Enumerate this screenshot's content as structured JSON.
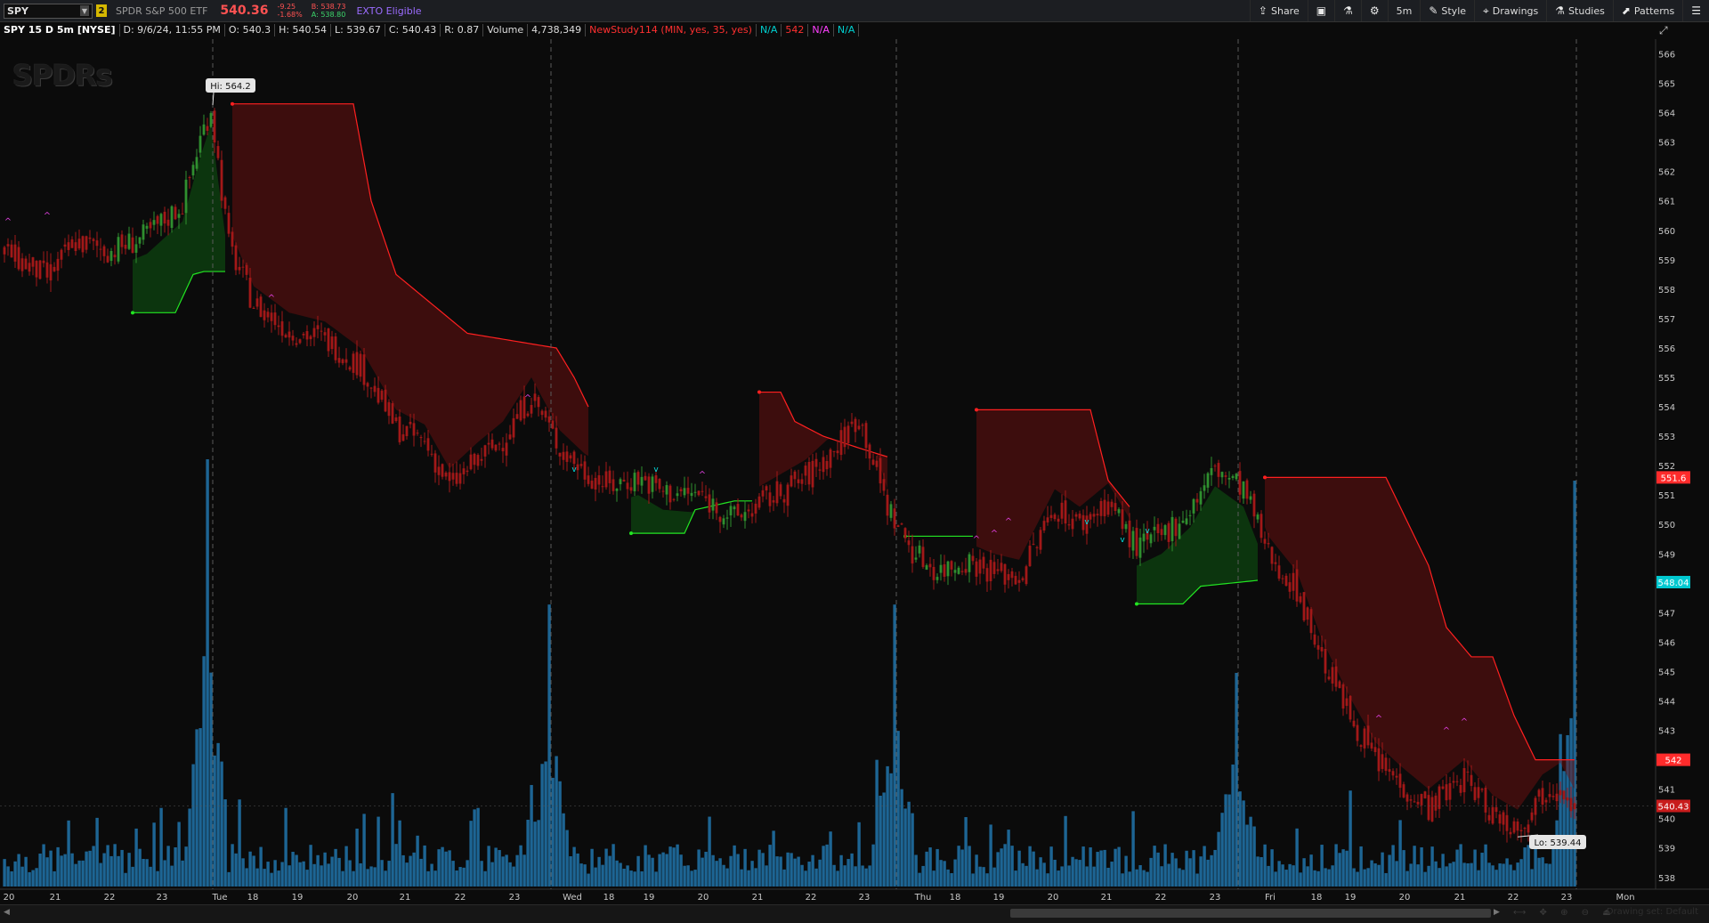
{
  "toolbar": {
    "symbol": "SPY",
    "link_badge": "2",
    "description": "SPDR S&P 500 ETF",
    "last_price": "540.36",
    "change_abs": "-9.25",
    "change_pct": "-1.68%",
    "bid": "B: 538.73",
    "ask": "A: 538.80",
    "exto": "EXTO Eligible",
    "buttons": [
      "Share",
      "5m",
      "Style",
      "Drawings",
      "Studies",
      "Patterns"
    ]
  },
  "study_bar": {
    "title": "SPY 15 D 5m [NYSE]",
    "date": "D: 9/6/24, 11:55 PM",
    "open": "O: 540.3",
    "high": "H: 540.54",
    "low": "L: 539.67",
    "close": "C: 540.43",
    "range": "R: 0.87",
    "volume_label": "Volume",
    "volume_value": "4,738,349",
    "study_name": "NewStudy114 (MIN, yes, 35, yes)",
    "na1": "N/A",
    "value_542": "542",
    "na2": "N/A",
    "na3": "N/A"
  },
  "logo_text": "SPDRs",
  "bottom": {
    "drawing_set": "Drawing set: Default"
  },
  "chart_data": {
    "type": "candlestick",
    "ylim": [
      537.6,
      566.5
    ],
    "y_ticks": [
      538,
      539,
      540,
      541,
      542,
      543,
      544,
      545,
      546,
      547,
      548,
      549,
      550,
      551,
      552,
      553,
      554,
      555,
      556,
      557,
      558,
      559,
      560,
      561,
      562,
      563,
      564,
      565,
      566
    ],
    "x_ticks": [
      "20",
      "21",
      "22",
      "23",
      "Tue",
      "18",
      "19",
      "20",
      "21",
      "22",
      "23",
      "Wed",
      "18",
      "19",
      "20",
      "21",
      "22",
      "23",
      "Thu",
      "18",
      "19",
      "20",
      "21",
      "22",
      "23",
      "Fri",
      "18",
      "19",
      "20",
      "21",
      "22",
      "23",
      "Mon"
    ],
    "day_separators": [
      "Tue",
      "Wed",
      "Thu",
      "Fri",
      "Mon"
    ],
    "price_path": [
      [
        0,
        559.3
      ],
      [
        12,
        558.4
      ],
      [
        20,
        559.6
      ],
      [
        30,
        559.3
      ],
      [
        40,
        559.8
      ],
      [
        50,
        560.9
      ],
      [
        55,
        563.1
      ],
      [
        58,
        564.2
      ],
      [
        63,
        559.5
      ],
      [
        70,
        557.5
      ],
      [
        80,
        556.6
      ],
      [
        90,
        556.3
      ],
      [
        100,
        555.4
      ],
      [
        110,
        553.3
      ],
      [
        118,
        552.8
      ],
      [
        125,
        551.3
      ],
      [
        133,
        552.2
      ],
      [
        140,
        552.9
      ],
      [
        148,
        554.4
      ],
      [
        156,
        552.6
      ],
      [
        163,
        551.8
      ],
      [
        170,
        551.3
      ],
      [
        178,
        551.6
      ],
      [
        185,
        551.1
      ],
      [
        195,
        551.0
      ],
      [
        205,
        550.2
      ],
      [
        215,
        550.9
      ],
      [
        225,
        551.6
      ],
      [
        233,
        552.5
      ],
      [
        240,
        553.7
      ],
      [
        248,
        550.6
      ],
      [
        255,
        549.1
      ],
      [
        262,
        548.4
      ],
      [
        270,
        548.8
      ],
      [
        278,
        548.4
      ],
      [
        285,
        548.2
      ],
      [
        295,
        550.6
      ],
      [
        302,
        550.0
      ],
      [
        310,
        550.8
      ],
      [
        318,
        549.2
      ],
      [
        325,
        549.6
      ],
      [
        333,
        550.5
      ],
      [
        340,
        551.9
      ],
      [
        348,
        551.2
      ],
      [
        355,
        549.0
      ],
      [
        363,
        547.8
      ],
      [
        370,
        545.5
      ],
      [
        378,
        543.5
      ],
      [
        385,
        542.0
      ],
      [
        392,
        541.2
      ],
      [
        400,
        540.4
      ],
      [
        410,
        541.4
      ],
      [
        418,
        540.2
      ],
      [
        425,
        539.7
      ],
      [
        432,
        540.9
      ],
      [
        437,
        541.3
      ],
      [
        441,
        540.4
      ]
    ],
    "current_price": 540.43,
    "labels": {
      "hi": "Hi: 564.2",
      "lo": "Lo: 539.44"
    },
    "price_badges": [
      {
        "value": "551.6",
        "price": 551.6,
        "color": "#ff2b2b"
      },
      {
        "value": "548.04",
        "price": 548.04,
        "color": "#00c8d0"
      },
      {
        "value": "542",
        "price": 542.0,
        "color": "#ff2b2b"
      },
      {
        "value": "540.43",
        "price": 540.43,
        "color": "#c81c1c"
      }
    ],
    "resistance_zones": [
      {
        "start": 64,
        "end": 164,
        "top": [
          [
            64,
            564.3
          ],
          [
            98,
            564.3
          ],
          [
            103,
            561.0
          ],
          [
            110,
            558.5
          ],
          [
            115,
            558.0
          ],
          [
            125,
            557.0
          ],
          [
            130,
            556.5
          ],
          [
            155,
            556.0
          ],
          [
            160,
            555.0
          ],
          [
            164,
            554.0
          ]
        ]
      },
      {
        "start": 212,
        "end": 248,
        "top": [
          [
            212,
            554.5
          ],
          [
            218,
            554.5
          ],
          [
            222,
            553.5
          ],
          [
            230,
            553.0
          ],
          [
            240,
            552.6
          ],
          [
            248,
            552.3
          ]
        ]
      },
      {
        "start": 273,
        "end": 316,
        "top": [
          [
            273,
            553.9
          ],
          [
            305,
            553.9
          ],
          [
            310,
            551.5
          ],
          [
            316,
            550.6
          ]
        ]
      },
      {
        "start": 354,
        "end": 441,
        "top": [
          [
            354,
            551.6
          ],
          [
            388,
            551.6
          ],
          [
            400,
            548.6
          ],
          [
            405,
            546.5
          ],
          [
            412,
            545.5
          ],
          [
            418,
            545.5
          ],
          [
            424,
            543.5
          ],
          [
            430,
            542.0
          ],
          [
            441,
            542.0
          ]
        ]
      }
    ],
    "support_zones": [
      {
        "start": 36,
        "end": 62,
        "bottom": [
          [
            36,
            557.2
          ],
          [
            48,
            557.2
          ],
          [
            53,
            558.5
          ],
          [
            56,
            558.6
          ],
          [
            62,
            558.6
          ]
        ]
      },
      {
        "start": 176,
        "end": 210,
        "bottom": [
          [
            176,
            549.7
          ],
          [
            191,
            549.7
          ],
          [
            194,
            550.5
          ],
          [
            205,
            550.8
          ],
          [
            210,
            550.8
          ]
        ]
      },
      {
        "start": 253,
        "end": 272,
        "bottom": [
          [
            253,
            549.6
          ],
          [
            272,
            549.6
          ]
        ]
      },
      {
        "start": 318,
        "end": 352,
        "bottom": [
          [
            318,
            547.3
          ],
          [
            331,
            547.3
          ],
          [
            336,
            547.9
          ],
          [
            352,
            548.1
          ]
        ]
      }
    ],
    "volume_spikes": [
      {
        "bar": 57,
        "value": 1.0
      },
      {
        "bar": 153,
        "value": 0.66
      },
      {
        "bar": 250,
        "value": 0.66
      },
      {
        "bar": 346,
        "value": 0.5
      },
      {
        "bar": 441,
        "value": 0.95
      }
    ]
  }
}
